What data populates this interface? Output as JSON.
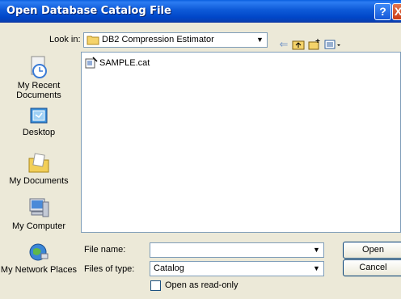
{
  "window": {
    "title": "Open Database Catalog File"
  },
  "lookin": {
    "label": "Look in:",
    "value": "DB2 Compression Estimator"
  },
  "toolbar": {
    "back_icon": "back-arrow-icon",
    "up_icon": "up-folder-icon",
    "new_folder_icon": "new-folder-icon",
    "views_icon": "views-menu-icon"
  },
  "places": [
    {
      "label": "My Recent Documents",
      "icon": "recent-documents-icon"
    },
    {
      "label": "Desktop",
      "icon": "desktop-icon"
    },
    {
      "label": "My Documents",
      "icon": "my-documents-icon"
    },
    {
      "label": "My Computer",
      "icon": "my-computer-icon"
    },
    {
      "label": "My Network Places",
      "icon": "network-places-icon"
    }
  ],
  "files": [
    {
      "name": "SAMPLE.cat",
      "icon": "catalog-file-icon"
    }
  ],
  "filename": {
    "label": "File name:",
    "value": ""
  },
  "filetype": {
    "label": "Files of type:",
    "value": "Catalog"
  },
  "readonly": {
    "label": "Open as read-only",
    "checked": false
  },
  "buttons": {
    "open": "Open",
    "cancel": "Cancel"
  }
}
